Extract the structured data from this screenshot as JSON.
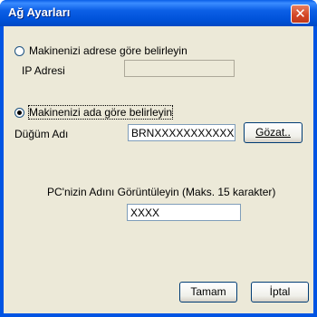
{
  "window": {
    "title": "Ağ Ayarları",
    "close_glyph": "✕"
  },
  "option_address": {
    "label": "Makinenizi adrese göre belirleyin",
    "checked": false
  },
  "ip_address": {
    "label": "IP Adresi",
    "value": ""
  },
  "option_name": {
    "label": "Makinenizi ada göre belirleyin",
    "checked": true
  },
  "node_name": {
    "label": "Düğüm Adı",
    "value": "BRNXXXXXXXXXXXX"
  },
  "browse_button": {
    "label": "Gözat.."
  },
  "pc_display": {
    "label": "PC'nizin Adını Görüntüleyin (Maks. 15 karakter)",
    "value": "XXXX"
  },
  "ok_button": {
    "label": "Tamam"
  },
  "cancel_button": {
    "label": "İptal"
  }
}
